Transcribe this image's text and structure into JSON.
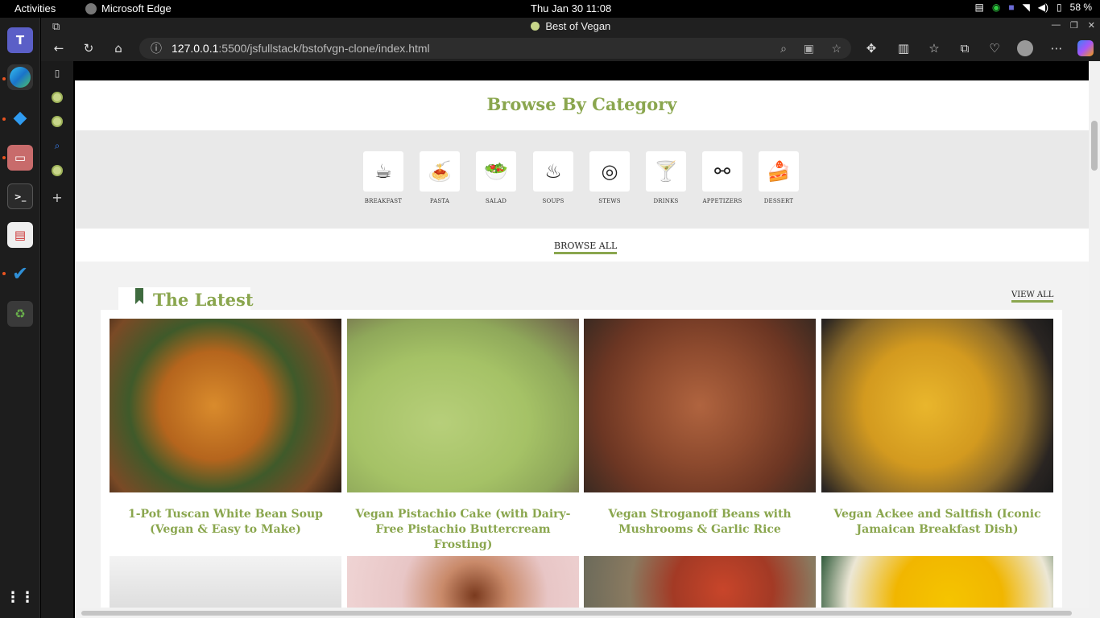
{
  "system": {
    "activities": "Activities",
    "app_name": "Microsoft Edge",
    "clock": "Thu Jan 30  11:08",
    "battery": "58 %"
  },
  "browser": {
    "window_title": "Best of Vegan",
    "url_host": "127.0.0.1",
    "url_path": ":5500/jsfullstack/bstofvgn-clone/index.html"
  },
  "page": {
    "category_heading": "Browse By Category",
    "categories": [
      {
        "label": "BREAKFAST",
        "icon": "coffee-croissant-icon"
      },
      {
        "label": "PASTA",
        "icon": "pasta-fork-icon"
      },
      {
        "label": "SALAD",
        "icon": "salad-bowl-icon"
      },
      {
        "label": "SOUPS",
        "icon": "soup-bowl-icon"
      },
      {
        "label": "STEWS",
        "icon": "stew-pot-icon"
      },
      {
        "label": "DRINKS",
        "icon": "cocktail-icon"
      },
      {
        "label": "APPETIZERS",
        "icon": "skewer-icon"
      },
      {
        "label": "DESSERT",
        "icon": "cake-icon"
      }
    ],
    "browse_all": "BROWSE ALL",
    "latest_heading": "The Latest",
    "view_all": "VIEW ALL",
    "recipes": [
      {
        "title": "1-Pot Tuscan White Bean Soup (Vegan & Easy to Make)"
      },
      {
        "title": "Vegan Pistachio Cake (with Dairy-Free Pistachio Buttercream Frosting)"
      },
      {
        "title": "Vegan Stroganoff Beans with Mushrooms & Garlic Rice"
      },
      {
        "title": "Vegan Ackee and Saltfish (Iconic Jamaican Breakfast Dish)"
      }
    ]
  },
  "colors": {
    "accent": "#8aa64e",
    "bookmark": "#3f6b3f"
  }
}
